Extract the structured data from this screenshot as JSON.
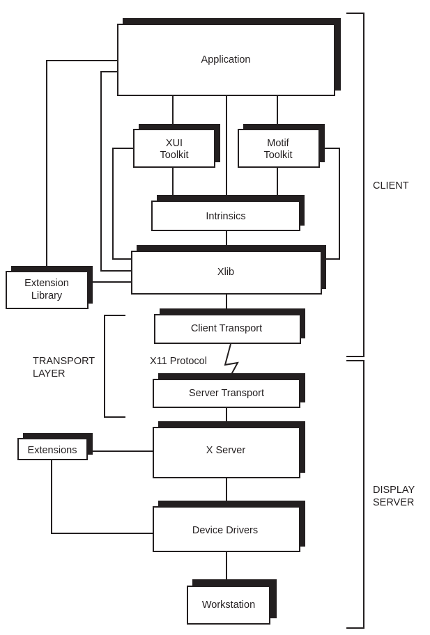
{
  "colors": {
    "ink": "#231f20",
    "background": "#ffffff"
  },
  "boxes": {
    "application": "Application",
    "xui_1": "XUI",
    "xui_2": "Toolkit",
    "motif_1": "Motif",
    "motif_2": "Toolkit",
    "intrinsics": "Intrinsics",
    "xlib": "Xlib",
    "extlib_1": "Extension",
    "extlib_2": "Library",
    "client_transport": "Client Transport",
    "server_transport": "Server Transport",
    "x_server": "X Server",
    "extensions": "Extensions",
    "device_drivers": "Device Drivers",
    "workstation": "Workstation"
  },
  "labels": {
    "protocol": "X11 Protocol",
    "client": "CLIENT",
    "transport_1": "TRANSPORT",
    "transport_2": "LAYER",
    "display_1": "DISPLAY",
    "display_2": "SERVER"
  }
}
